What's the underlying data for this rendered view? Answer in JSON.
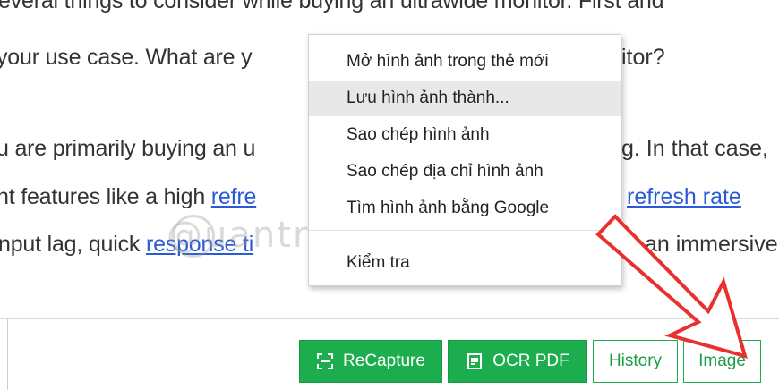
{
  "article": {
    "line1": "everal things to consider while buying an ultrawide monitor. First and",
    "line2_a": "your use case. What are y",
    "line2_b": "itor?",
    "line3_a": "u are primarily buying an u",
    "line3_b": "g. In that case,",
    "line4_a": "nt features like a high ",
    "line4_link1": "refre",
    "line4_link2": "refresh rate",
    "line5_a": "nput lag, quick ",
    "line5_link": "response ti",
    "line5_b": "an immersive"
  },
  "watermark": "@uantrimang",
  "context_menu": {
    "items": [
      "Mở hình ảnh trong thẻ mới",
      "Lưu hình ảnh thành...",
      "Sao chép hình ảnh",
      "Sao chép địa chỉ hình ảnh",
      "Tìm hình ảnh bằng Google",
      "Kiểm tra"
    ],
    "highlighted_index": 1
  },
  "toolbar": {
    "recapture_label": "ReCapture",
    "ocr_pdf_label": "OCR PDF",
    "history_label": "History",
    "image_label": "Image"
  },
  "colors": {
    "accent_green": "#1cae4e",
    "arrow_red": "#e8312f",
    "link_blue": "#2a5bd7"
  }
}
